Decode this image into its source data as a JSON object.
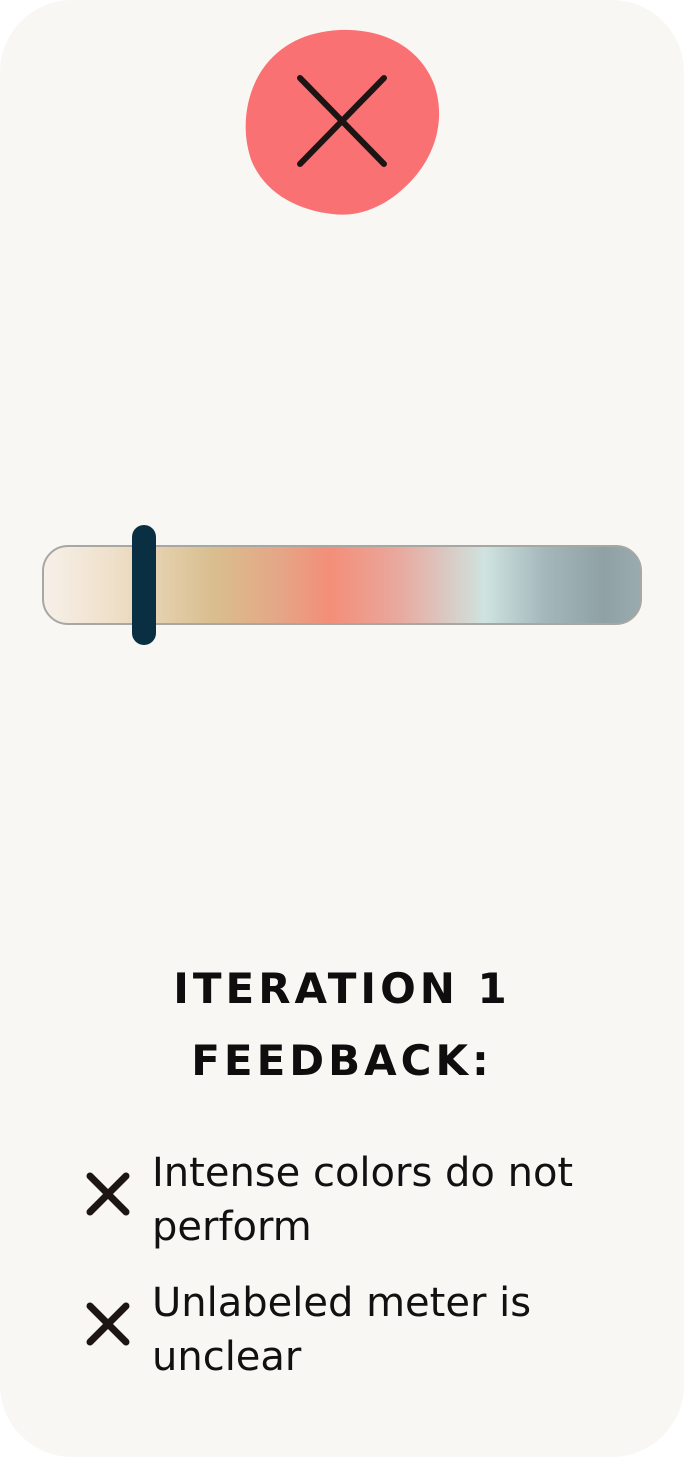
{
  "colors": {
    "card_background": "#f8f7f4",
    "blob_fill": "#fa7174",
    "thumb": "#0b2f42",
    "text": "#111111"
  },
  "status_icon": "close-icon",
  "meter": {
    "value_fraction": 0.17,
    "gradient_stops": [
      "#f7f0e9",
      "#eedfc8",
      "#d9bf8f",
      "#e5a586",
      "#f38e78",
      "#e8aaa0",
      "#cfe3e0",
      "#a4b7bb",
      "#8fa1a5",
      "#9aabaf"
    ]
  },
  "heading": {
    "line1": "ITERATION 1",
    "line2": "FEEDBACK:"
  },
  "feedback": [
    {
      "icon": "x-icon",
      "line1": "Intense colors do not",
      "line2": "perform"
    },
    {
      "icon": "x-icon",
      "line1": "Unlabeled meter is",
      "line2": "unclear"
    }
  ]
}
